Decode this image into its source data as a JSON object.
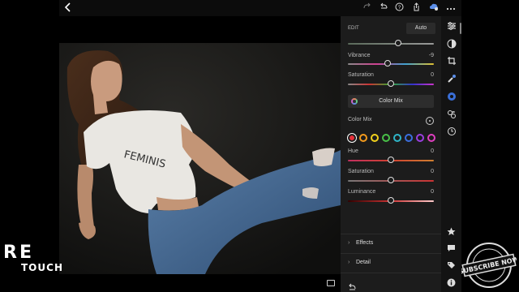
{
  "topbar": {
    "back_icon": "chevron-left-icon",
    "icons": [
      "redo-icon",
      "undo-icon",
      "help-icon",
      "share-icon",
      "cloud-sync-icon",
      "more-icon"
    ]
  },
  "photo": {
    "shirt_text": "FEMINIS"
  },
  "edit_panel": {
    "section_title": "EDIT",
    "auto_label": "Auto",
    "top_slider": {
      "value": "",
      "position": 0.6
    },
    "vibrance": {
      "label": "Vibrance",
      "value": "-9",
      "position": 0.45
    },
    "saturation": {
      "label": "Saturation",
      "value": "0",
      "position": 0.5
    },
    "color_mix_button": "Color Mix",
    "color_mix_title": "Color Mix",
    "swatches": [
      "#e8303a",
      "#f39a1d",
      "#f2d21c",
      "#49c248",
      "#2fb6c9",
      "#3b6fe0",
      "#9b3fe0",
      "#e03fc1"
    ],
    "hue": {
      "label": "Hue",
      "value": "0",
      "position": 0.5
    },
    "cm_saturation": {
      "label": "Saturation",
      "value": "0",
      "position": 0.5
    },
    "luminance": {
      "label": "Luminance",
      "value": "0",
      "position": 0.5
    },
    "effects_label": "Effects",
    "detail_label": "Detail"
  },
  "right_toolbar": {
    "icons": [
      "sliders-icon",
      "presets-icon",
      "crop-icon",
      "healing-icon",
      "selective-icon",
      "versions-icon",
      "history-icon",
      "star-icon",
      "comment-icon",
      "tag-icon",
      "info-icon"
    ]
  },
  "watermark": {
    "big": "RE",
    "small": "TOUCH",
    "stamp_text": "SUBSCRIBE NOW"
  },
  "colors": {
    "panel_bg": "#1c1c1c",
    "toolbar_bg": "#131313"
  }
}
